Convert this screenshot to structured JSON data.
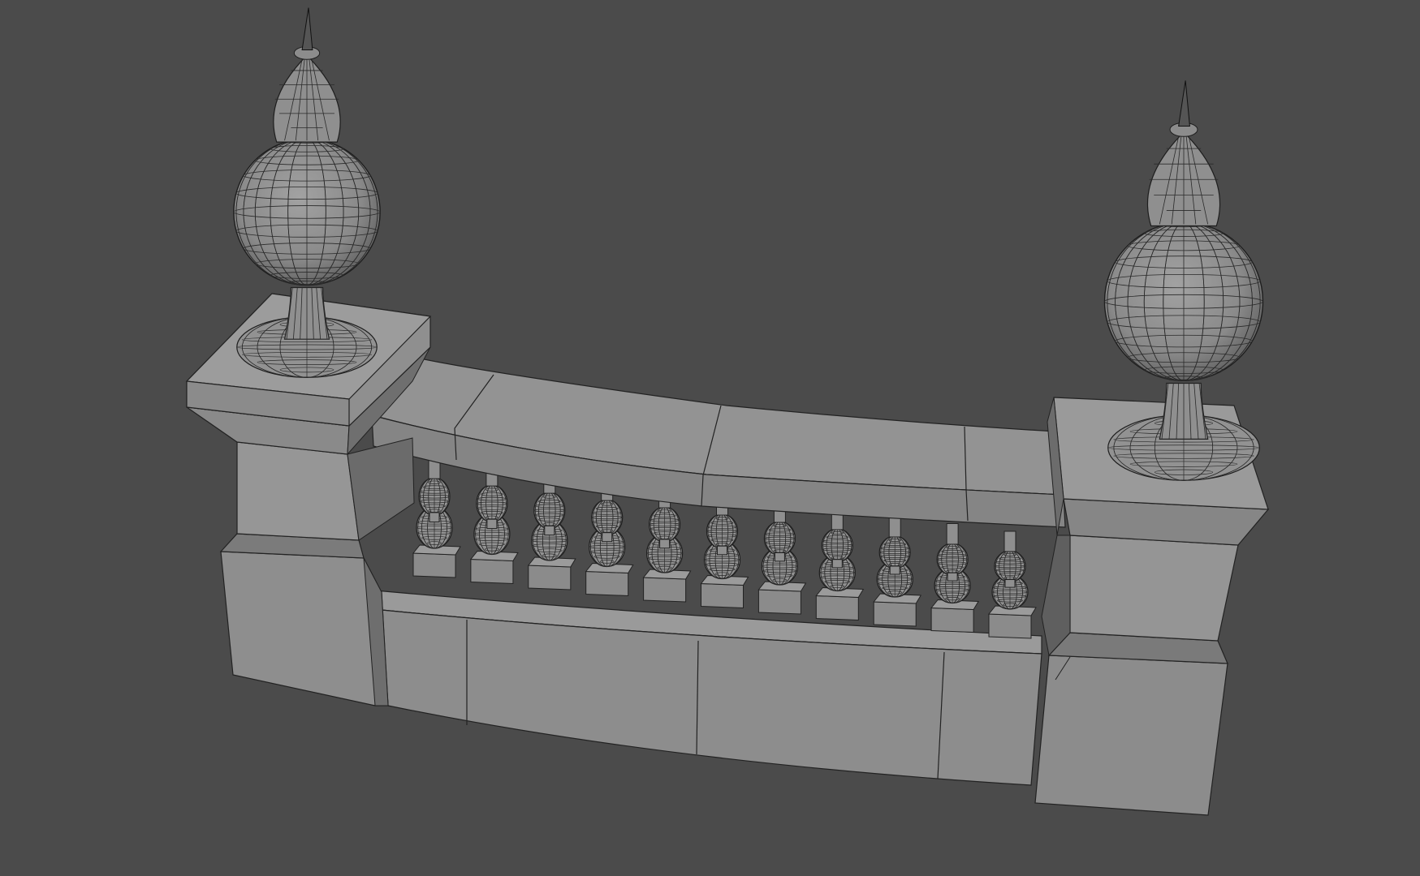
{
  "viewport": {
    "background": "#4b4b4b",
    "mesh_color": "#8c8c8c",
    "wire_color": "#1e1e1e"
  },
  "model": {
    "subject": "balustrade",
    "parts": [
      "left-pedestal",
      "left-finial",
      "right-pedestal",
      "right-finial",
      "handrail",
      "base-rail",
      "balusters"
    ],
    "baluster_count": 11
  }
}
